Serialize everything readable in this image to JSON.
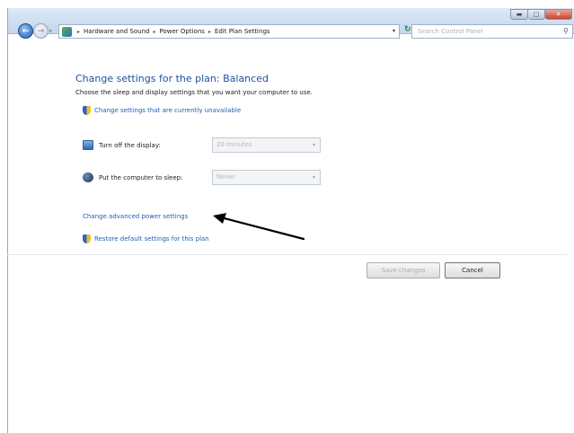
{
  "window": {
    "controls": {
      "minimize": "▬",
      "maximize": "□",
      "close": "✕"
    }
  },
  "address_bar": {
    "breadcrumbs": [
      "Hardware and Sound",
      "Power Options",
      "Edit Plan Settings"
    ],
    "separator": "▸",
    "dropdown_glyph": "▾",
    "refresh_glyph": "↻"
  },
  "search": {
    "placeholder": "Search Control Panel"
  },
  "main": {
    "title": "Change settings for the plan: Balanced",
    "description": "Choose the sleep and display settings that you want your computer to use.",
    "unavailable_link": "Change settings that are currently unavailable",
    "settings": [
      {
        "label": "Turn off the display:",
        "value": "20 minutes",
        "icon": "monitor-icon"
      },
      {
        "label": "Put the computer to sleep:",
        "value": "Never",
        "icon": "sleep-icon"
      }
    ],
    "advanced_link": "Change advanced power settings",
    "restore_link": "Restore default settings for this plan"
  },
  "buttons": {
    "save": "Save changes",
    "cancel": "Cancel"
  },
  "colors": {
    "link": "#1e5fb8",
    "title": "#1f4f9e",
    "arrow": "#000000"
  }
}
